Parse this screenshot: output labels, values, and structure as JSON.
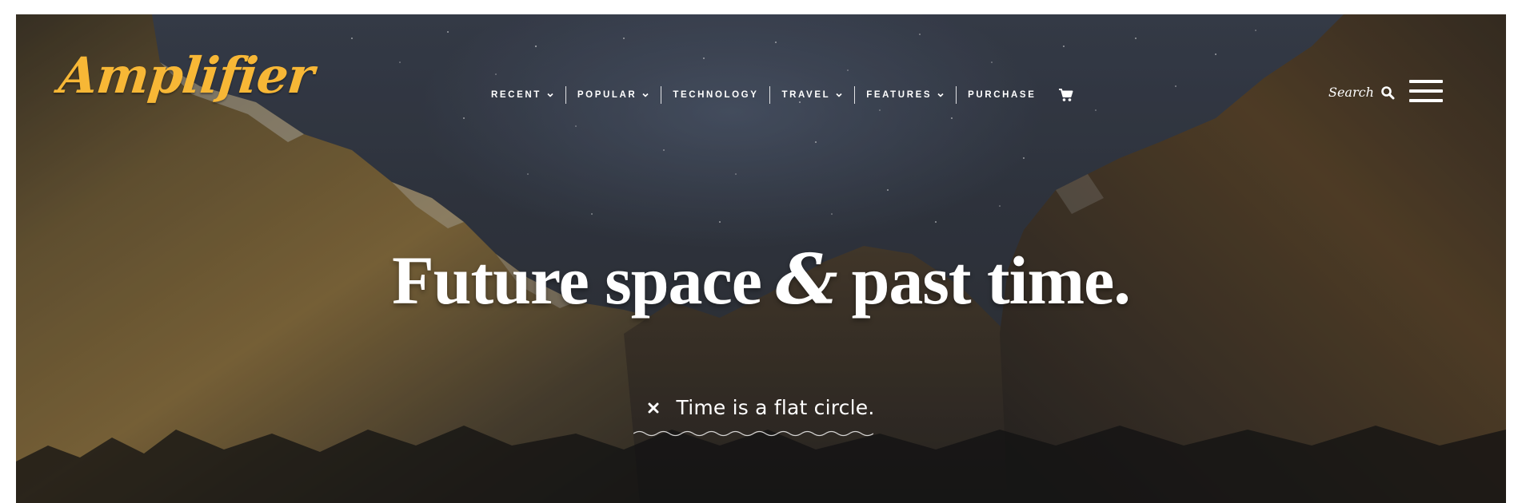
{
  "site": {
    "logo": "Amplifier"
  },
  "nav": {
    "items": [
      {
        "label": "RECENT",
        "dropdown": true
      },
      {
        "label": "POPULAR",
        "dropdown": true
      },
      {
        "label": "TECHNOLOGY",
        "dropdown": false
      },
      {
        "label": "TRAVEL",
        "dropdown": true
      },
      {
        "label": "FEATURES",
        "dropdown": true
      },
      {
        "label": "PURCHASE",
        "dropdown": false
      }
    ],
    "cart_icon": "shopping-cart-icon"
  },
  "search": {
    "label": "Search",
    "icon": "search-icon"
  },
  "menu": {
    "icon": "hamburger-menu-icon"
  },
  "hero": {
    "headline_part1": "Future space",
    "headline_amp": "&",
    "headline_part2": "past time.",
    "tagline": "Time is a flat circle.",
    "tagline_icon": "close-icon"
  },
  "colors": {
    "brand": "#f7b736",
    "text": "#ffffff",
    "sky": "#3b4250",
    "rock": "#6b5a36"
  }
}
